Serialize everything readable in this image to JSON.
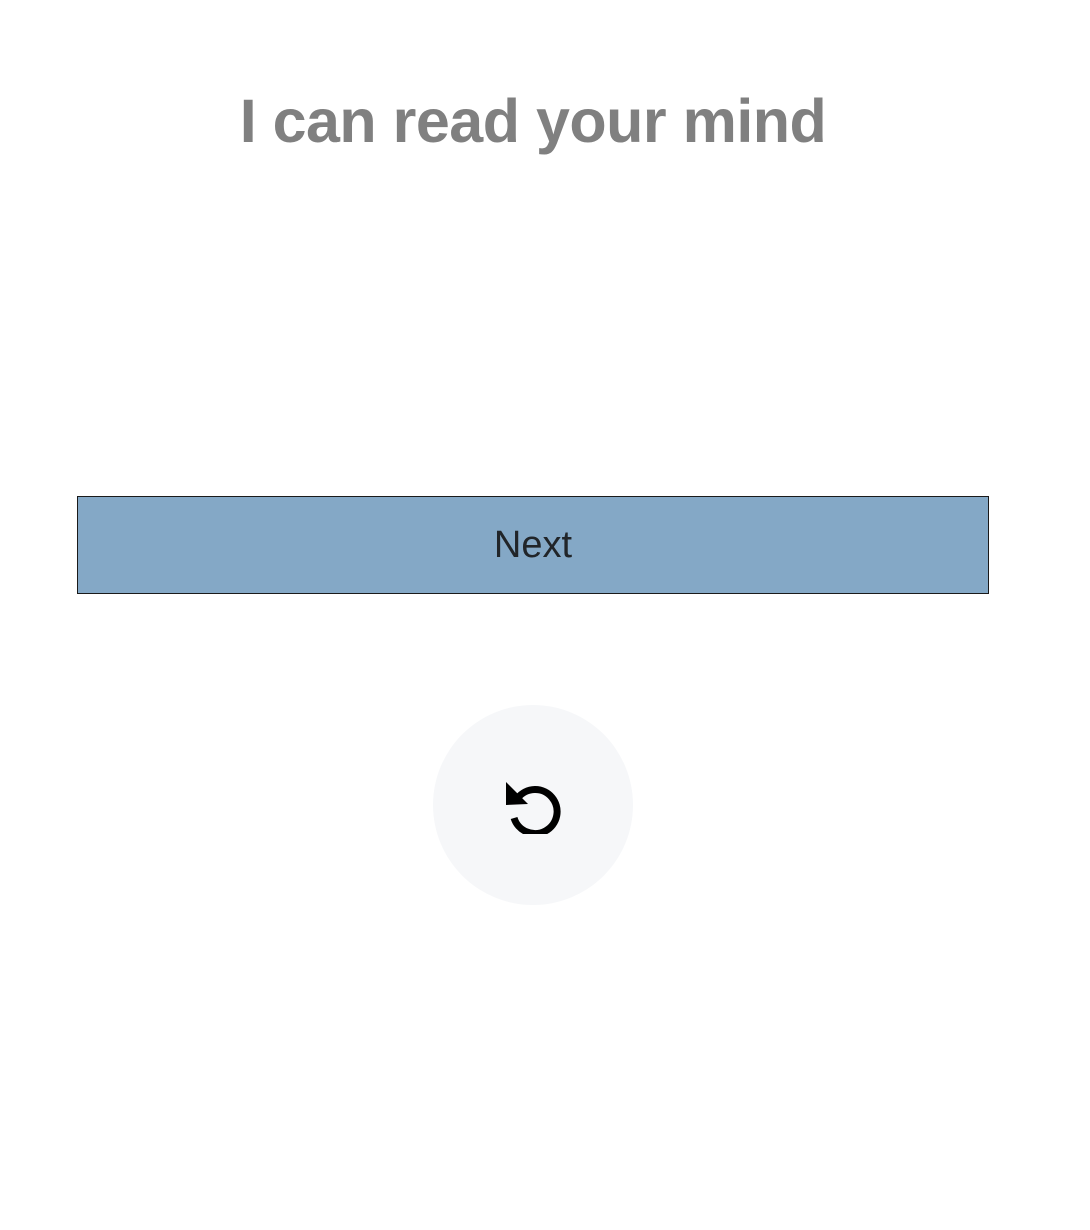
{
  "header": {
    "title": "I can read your mind"
  },
  "actions": {
    "next_label": "Next",
    "reset_icon": "reset-icon"
  },
  "colors": {
    "title": "#808080",
    "next_button_bg": "#84a8c6",
    "next_button_text": "#212529",
    "reset_button_bg": "#f6f7f9",
    "icon": "#000000"
  }
}
